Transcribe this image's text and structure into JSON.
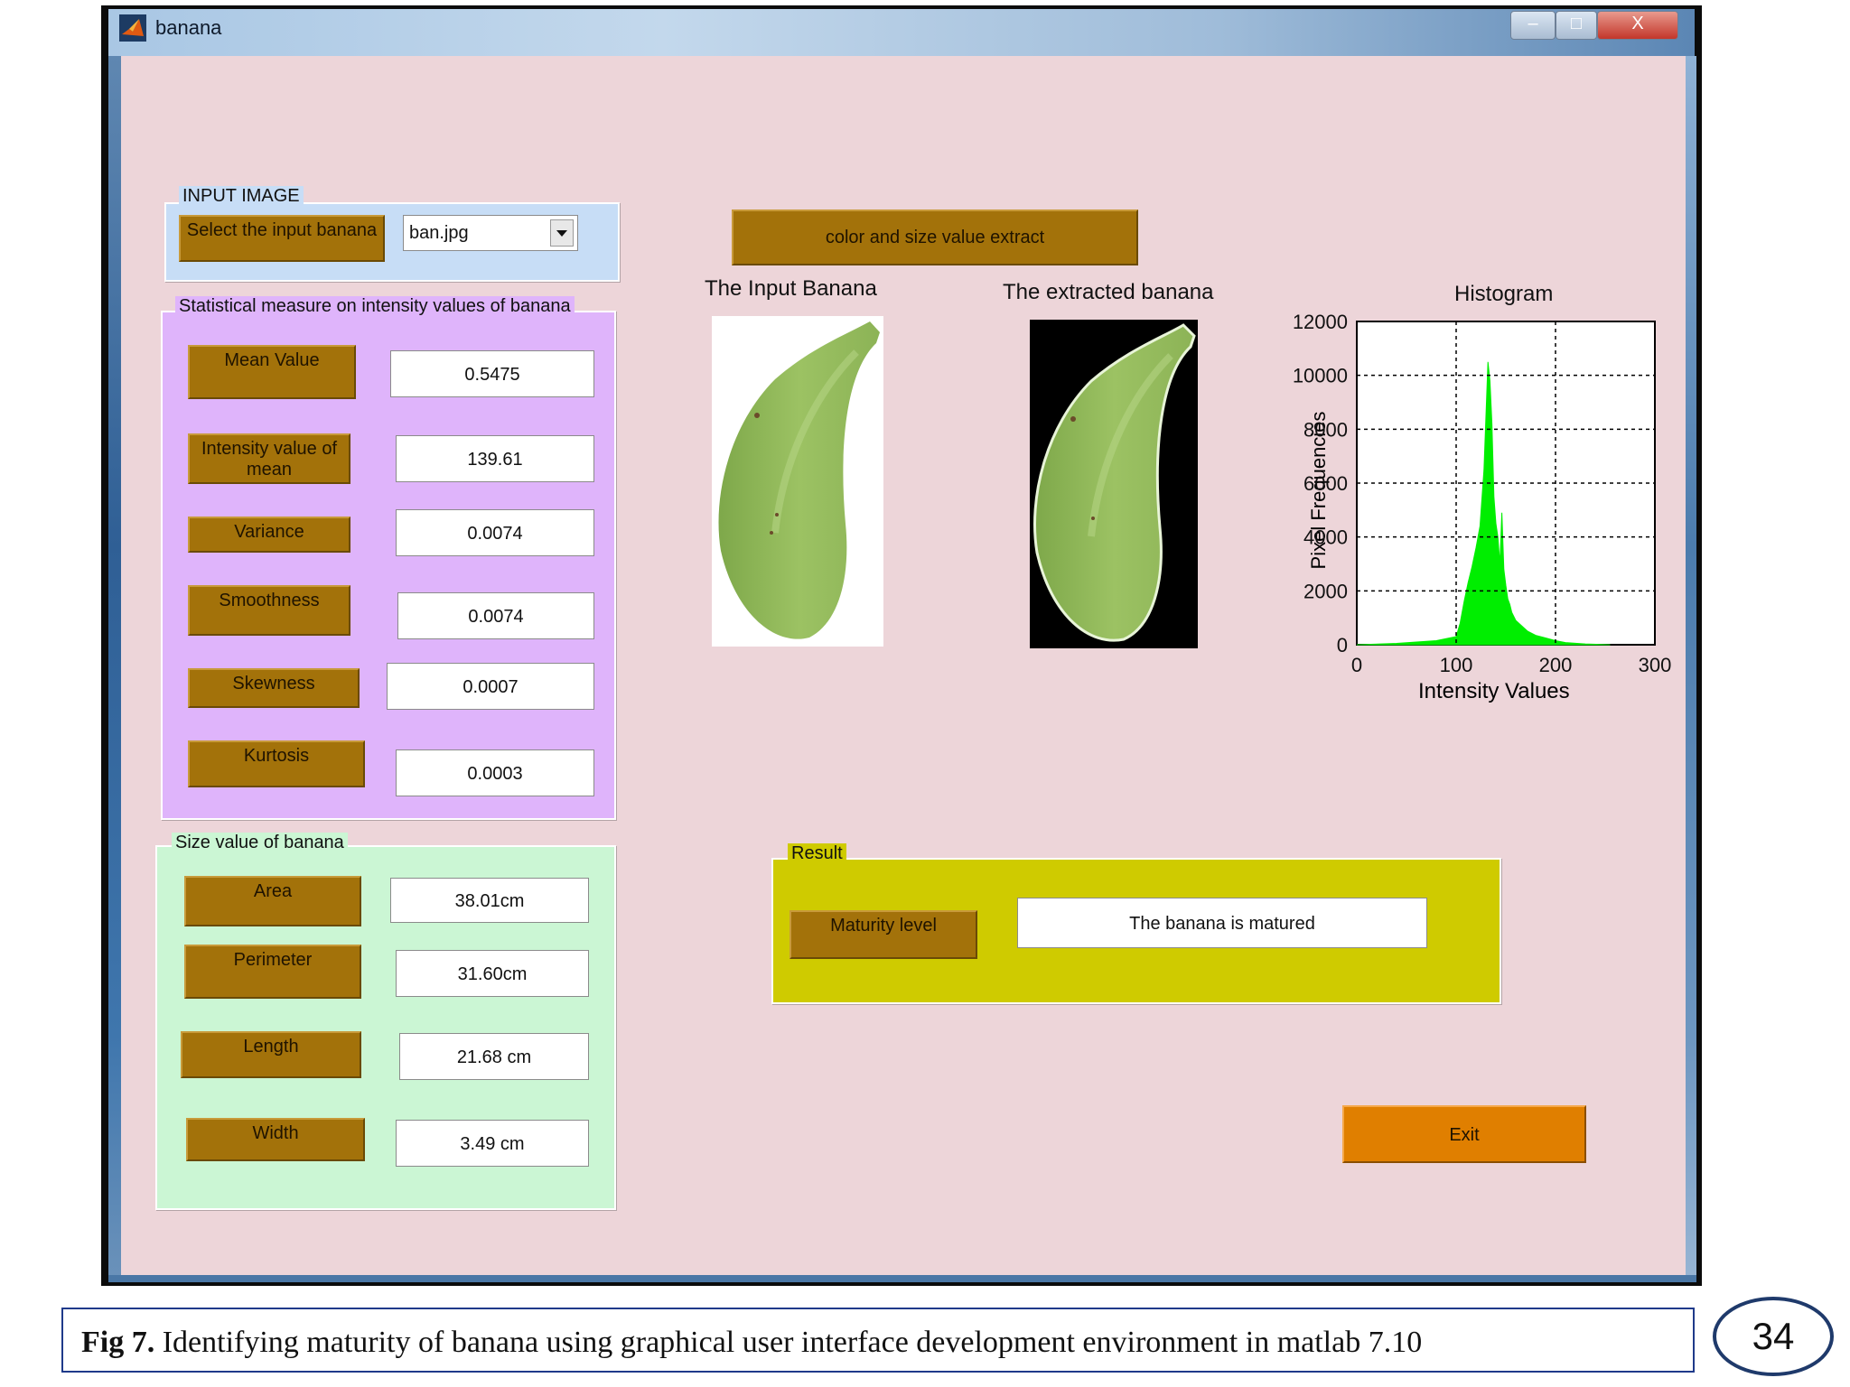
{
  "window": {
    "title": "banana",
    "controls": {
      "minimize": "–",
      "maximize": "□",
      "close": "X"
    }
  },
  "input_panel": {
    "title": "INPUT IMAGE",
    "select_label": "Select the input banana",
    "dropdown_value": "ban.jpg"
  },
  "extract_button": "color and size value extract",
  "stats_panel": {
    "title": "Statistical measure on intensity values of banana",
    "rows": [
      {
        "label": "Mean Value",
        "value": "0.5475"
      },
      {
        "label": "Intensity value of mean",
        "value": "139.61"
      },
      {
        "label": "Variance",
        "value": "0.0074"
      },
      {
        "label": "Smoothness",
        "value": "0.0074"
      },
      {
        "label": "Skewness",
        "value": "0.0007"
      },
      {
        "label": "Kurtosis",
        "value": "0.0003"
      }
    ]
  },
  "size_panel": {
    "title": "Size value of banana",
    "rows": [
      {
        "label": "Area",
        "value": "38.01cm"
      },
      {
        "label": "Perimeter",
        "value": "31.60cm"
      },
      {
        "label": "Length",
        "value": "21.68 cm"
      },
      {
        "label": "Width",
        "value": "3.49 cm"
      }
    ]
  },
  "images": {
    "input_title": "The Input Banana",
    "extracted_title": "The extracted banana"
  },
  "result_panel": {
    "title": "Result",
    "label": "Maturity level",
    "value": "The banana is matured"
  },
  "exit_button": "Exit",
  "caption": {
    "bold": "Fig 7.",
    "text": " Identifying maturity of banana using graphical user interface development environment in matlab 7.10"
  },
  "page_number": "34",
  "colors": {
    "client_bg": "#edd5d9",
    "button_brown": "#a3720a",
    "exit_orange": "#e07f00",
    "result_yellow": "#cfcb00",
    "stats_purple": "#dfb4fb",
    "size_green": "#cbf6d4",
    "input_blue": "#c7ddf6",
    "histogram_green": "#00ee00"
  },
  "chart_data": {
    "type": "area",
    "title": "Histogram",
    "xlabel": "Intensity Values",
    "ylabel": "Pixel Frequencies",
    "xlim": [
      0,
      300
    ],
    "ylim": [
      0,
      12000
    ],
    "xticks": [
      0,
      100,
      200,
      300
    ],
    "yticks": [
      0,
      2000,
      4000,
      6000,
      8000,
      10000,
      12000
    ],
    "grid": true,
    "x": [
      0,
      40,
      80,
      100,
      104,
      108,
      112,
      116,
      120,
      124,
      128,
      132,
      134,
      136,
      138,
      140,
      142,
      144,
      146,
      148,
      150,
      152,
      154,
      156,
      160,
      166,
      172,
      180,
      190,
      200,
      210,
      230,
      255
    ],
    "y": [
      0,
      50,
      150,
      300,
      800,
      1600,
      2300,
      2900,
      3600,
      4400,
      6500,
      10500,
      9800,
      8200,
      5500,
      4500,
      4000,
      3000,
      4900,
      2800,
      2200,
      1700,
      1500,
      1200,
      900,
      700,
      500,
      350,
      250,
      150,
      80,
      30,
      0
    ]
  }
}
